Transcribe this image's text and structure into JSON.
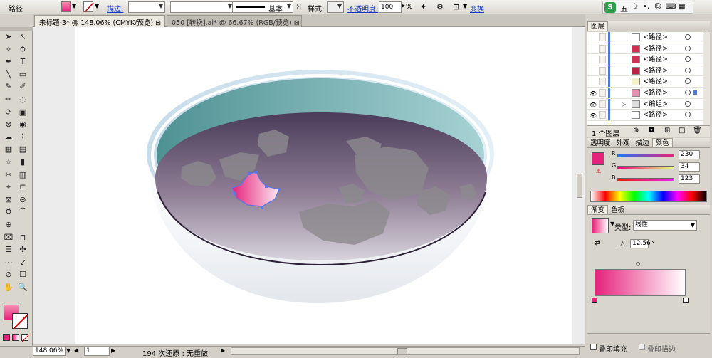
{
  "control_bar": {
    "object_type": "路径",
    "stroke_label": "描边:",
    "stroke_style": "基本",
    "style_label": "样式:",
    "opacity_label": "不透明度:",
    "opacity_value": "100",
    "opacity_unit": "%",
    "transform_label": "变换"
  },
  "ime": {
    "brand": "S",
    "mode": "五"
  },
  "tabs": [
    {
      "label": "未标题-3* @ 148.06% (CMYK/预览)",
      "close": "⊠",
      "active": true
    },
    {
      "label": "050 [转换].ai* @ 66.67% (RGB/预览)",
      "close": "⊠",
      "active": false
    }
  ],
  "status": {
    "zoom": "148.06%",
    "page": "1",
    "undo": "194 次还原 : 无重做"
  },
  "layers_panel": {
    "title": "图层",
    "rows": [
      {
        "name": "<路径>",
        "eye": false,
        "thumb": "#ffffff"
      },
      {
        "name": "<路径>",
        "eye": false,
        "thumb": "#d03050"
      },
      {
        "name": "<路径>",
        "eye": false,
        "thumb": "#cc3355"
      },
      {
        "name": "<路径>",
        "eye": false,
        "thumb": "#bb2244"
      },
      {
        "name": "<路径>",
        "eye": false,
        "thumb": "#f4f0c8"
      },
      {
        "name": "<路径>",
        "eye": true,
        "thumb": "#e890b0"
      },
      {
        "name": "<编组>",
        "eye": true,
        "thumb": "#dddddd"
      },
      {
        "name": "<路径>",
        "eye": true,
        "thumb": "#ffffff"
      }
    ],
    "footer": "1 个图层"
  },
  "color_panel": {
    "tabs": [
      "透明度",
      "外观",
      "描边",
      "颜色"
    ],
    "r_label": "R",
    "g_label": "G",
    "b_label": "B",
    "r": "230",
    "g": "34",
    "b": "123",
    "swatch": "#e6227b"
  },
  "gradient_panel": {
    "tabs": [
      "渐变",
      "色板"
    ],
    "type_label": "类型:",
    "type_value": "线性",
    "angle": "12.56"
  },
  "bottom_panel": {
    "overprint_fill": "叠印填充",
    "overprint_stroke": "叠印描边"
  },
  "colors": {
    "accent": "#e6227b",
    "bowl_rim": "#d6e6f0",
    "bowl_inner": "#8fc4c6",
    "soup": "#5a4a6a"
  }
}
